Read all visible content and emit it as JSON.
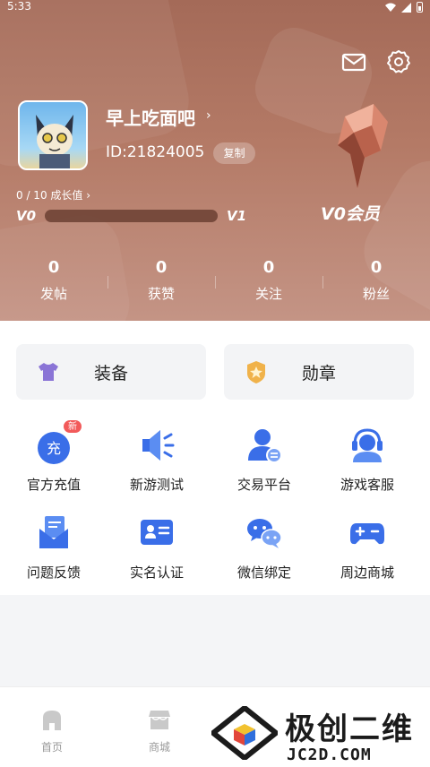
{
  "status_bar": {
    "time": "5:33"
  },
  "profile": {
    "nickname": "早上吃面吧",
    "name_chevron": "›",
    "user_id": "ID:21824005",
    "copy_label": "复制",
    "growth_text": "0 / 10 成长值 ›",
    "level_current": "V0",
    "level_next": "V1",
    "growth_progress_fraction": 0,
    "vip_label": "V0会员"
  },
  "stats": [
    {
      "value": "0",
      "label": "发帖"
    },
    {
      "value": "0",
      "label": "获赞"
    },
    {
      "value": "0",
      "label": "关注"
    },
    {
      "value": "0",
      "label": "粉丝"
    }
  ],
  "cards": [
    {
      "label": "装备",
      "icon": "shirt-icon"
    },
    {
      "label": "勋章",
      "icon": "medal-icon"
    }
  ],
  "services": [
    {
      "label": "官方充值",
      "icon": "recharge-icon",
      "badge": "新",
      "badge_icon_text": "充"
    },
    {
      "label": "新游测试",
      "icon": "megaphone-icon"
    },
    {
      "label": "交易平台",
      "icon": "trade-icon"
    },
    {
      "label": "游戏客服",
      "icon": "headset-icon"
    },
    {
      "label": "问题反馈",
      "icon": "feedback-icon"
    },
    {
      "label": "实名认证",
      "icon": "id-card-icon"
    },
    {
      "label": "微信绑定",
      "icon": "wechat-icon"
    },
    {
      "label": "周边商城",
      "icon": "gamepad-icon"
    }
  ],
  "bottom_nav": [
    {
      "label": "首页",
      "icon": "home-icon"
    },
    {
      "label": "商城",
      "icon": "store-icon"
    }
  ],
  "watermark": {
    "title": "极创二维",
    "subtitle": "JC2D.COM"
  },
  "colors": {
    "header_brown": "#a46a58",
    "accent_blue": "#3a6ee8",
    "badge_red": "#f25a5a"
  }
}
